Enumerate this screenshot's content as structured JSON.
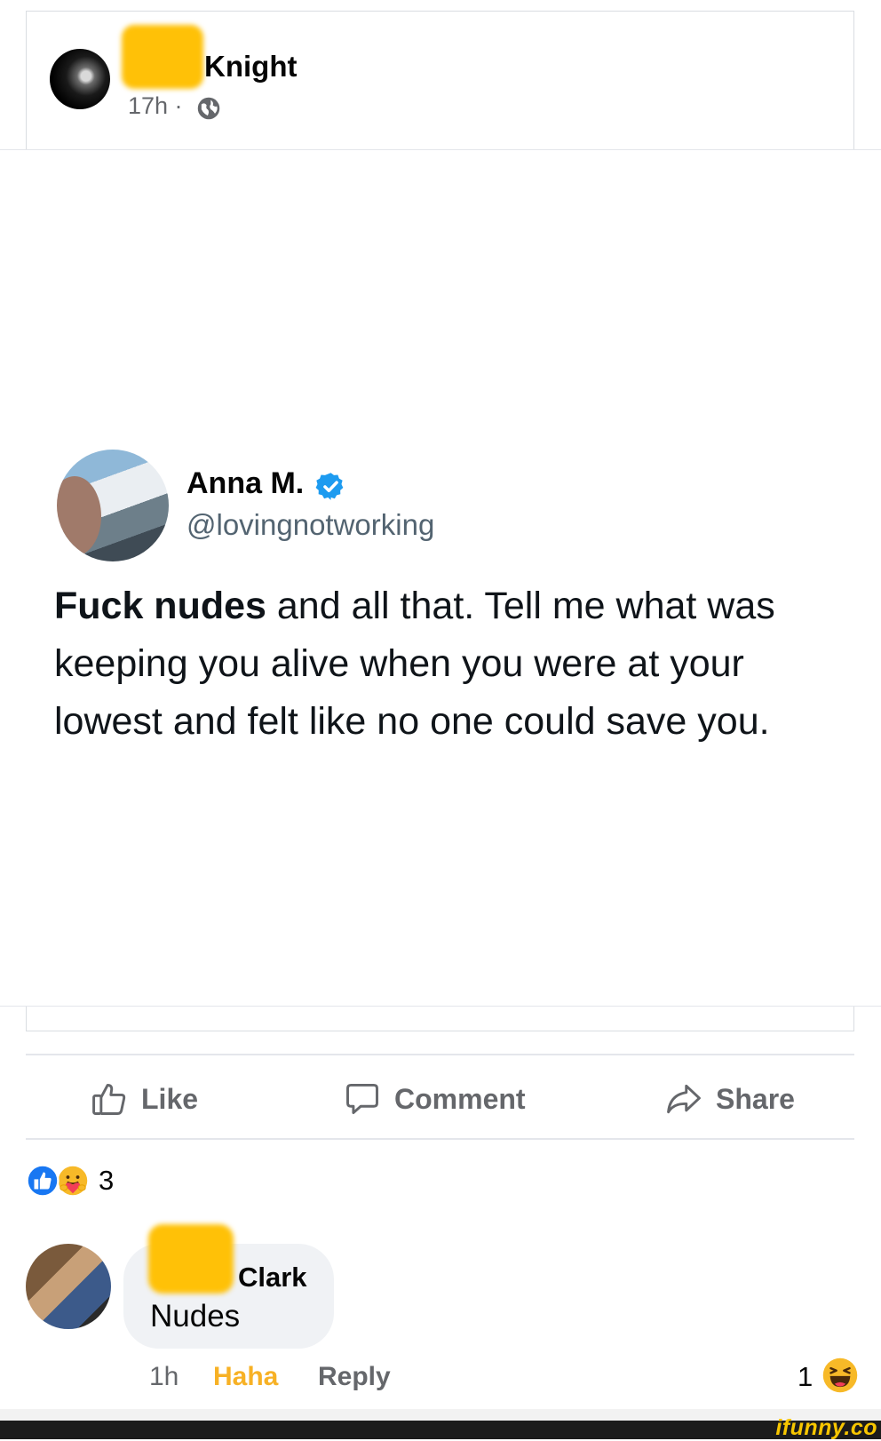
{
  "post": {
    "author_name": "Knight",
    "time": "17h ·",
    "privacy_icon": "globe-icon"
  },
  "tweet": {
    "author": "Anna M.",
    "verified": true,
    "handle": "@lovingnotworking",
    "text_bold": "Fuck nudes",
    "text_rest": " and all that. Tell me what was keeping you alive when you were at your lowest and felt like no one could save you."
  },
  "actions": {
    "like_label": "Like",
    "comment_label": "Comment",
    "share_label": "Share"
  },
  "reactions": {
    "icons": [
      "like-reaction-icon",
      "care-reaction-icon"
    ],
    "count": "3"
  },
  "comment": {
    "author_name": "Clark",
    "text": "Nudes",
    "time": "1h",
    "reaction_label": "Haha",
    "reply_label": "Reply",
    "reaction_count": "1",
    "reaction_icon": "haha-emoji-icon"
  },
  "watermark": {
    "text": "ifunny.co"
  },
  "colors": {
    "accent_blue": "#1d9bf0",
    "haha_yellow": "#f7b125",
    "secondary_text": "#65676b",
    "redaction": "#ffc107"
  }
}
